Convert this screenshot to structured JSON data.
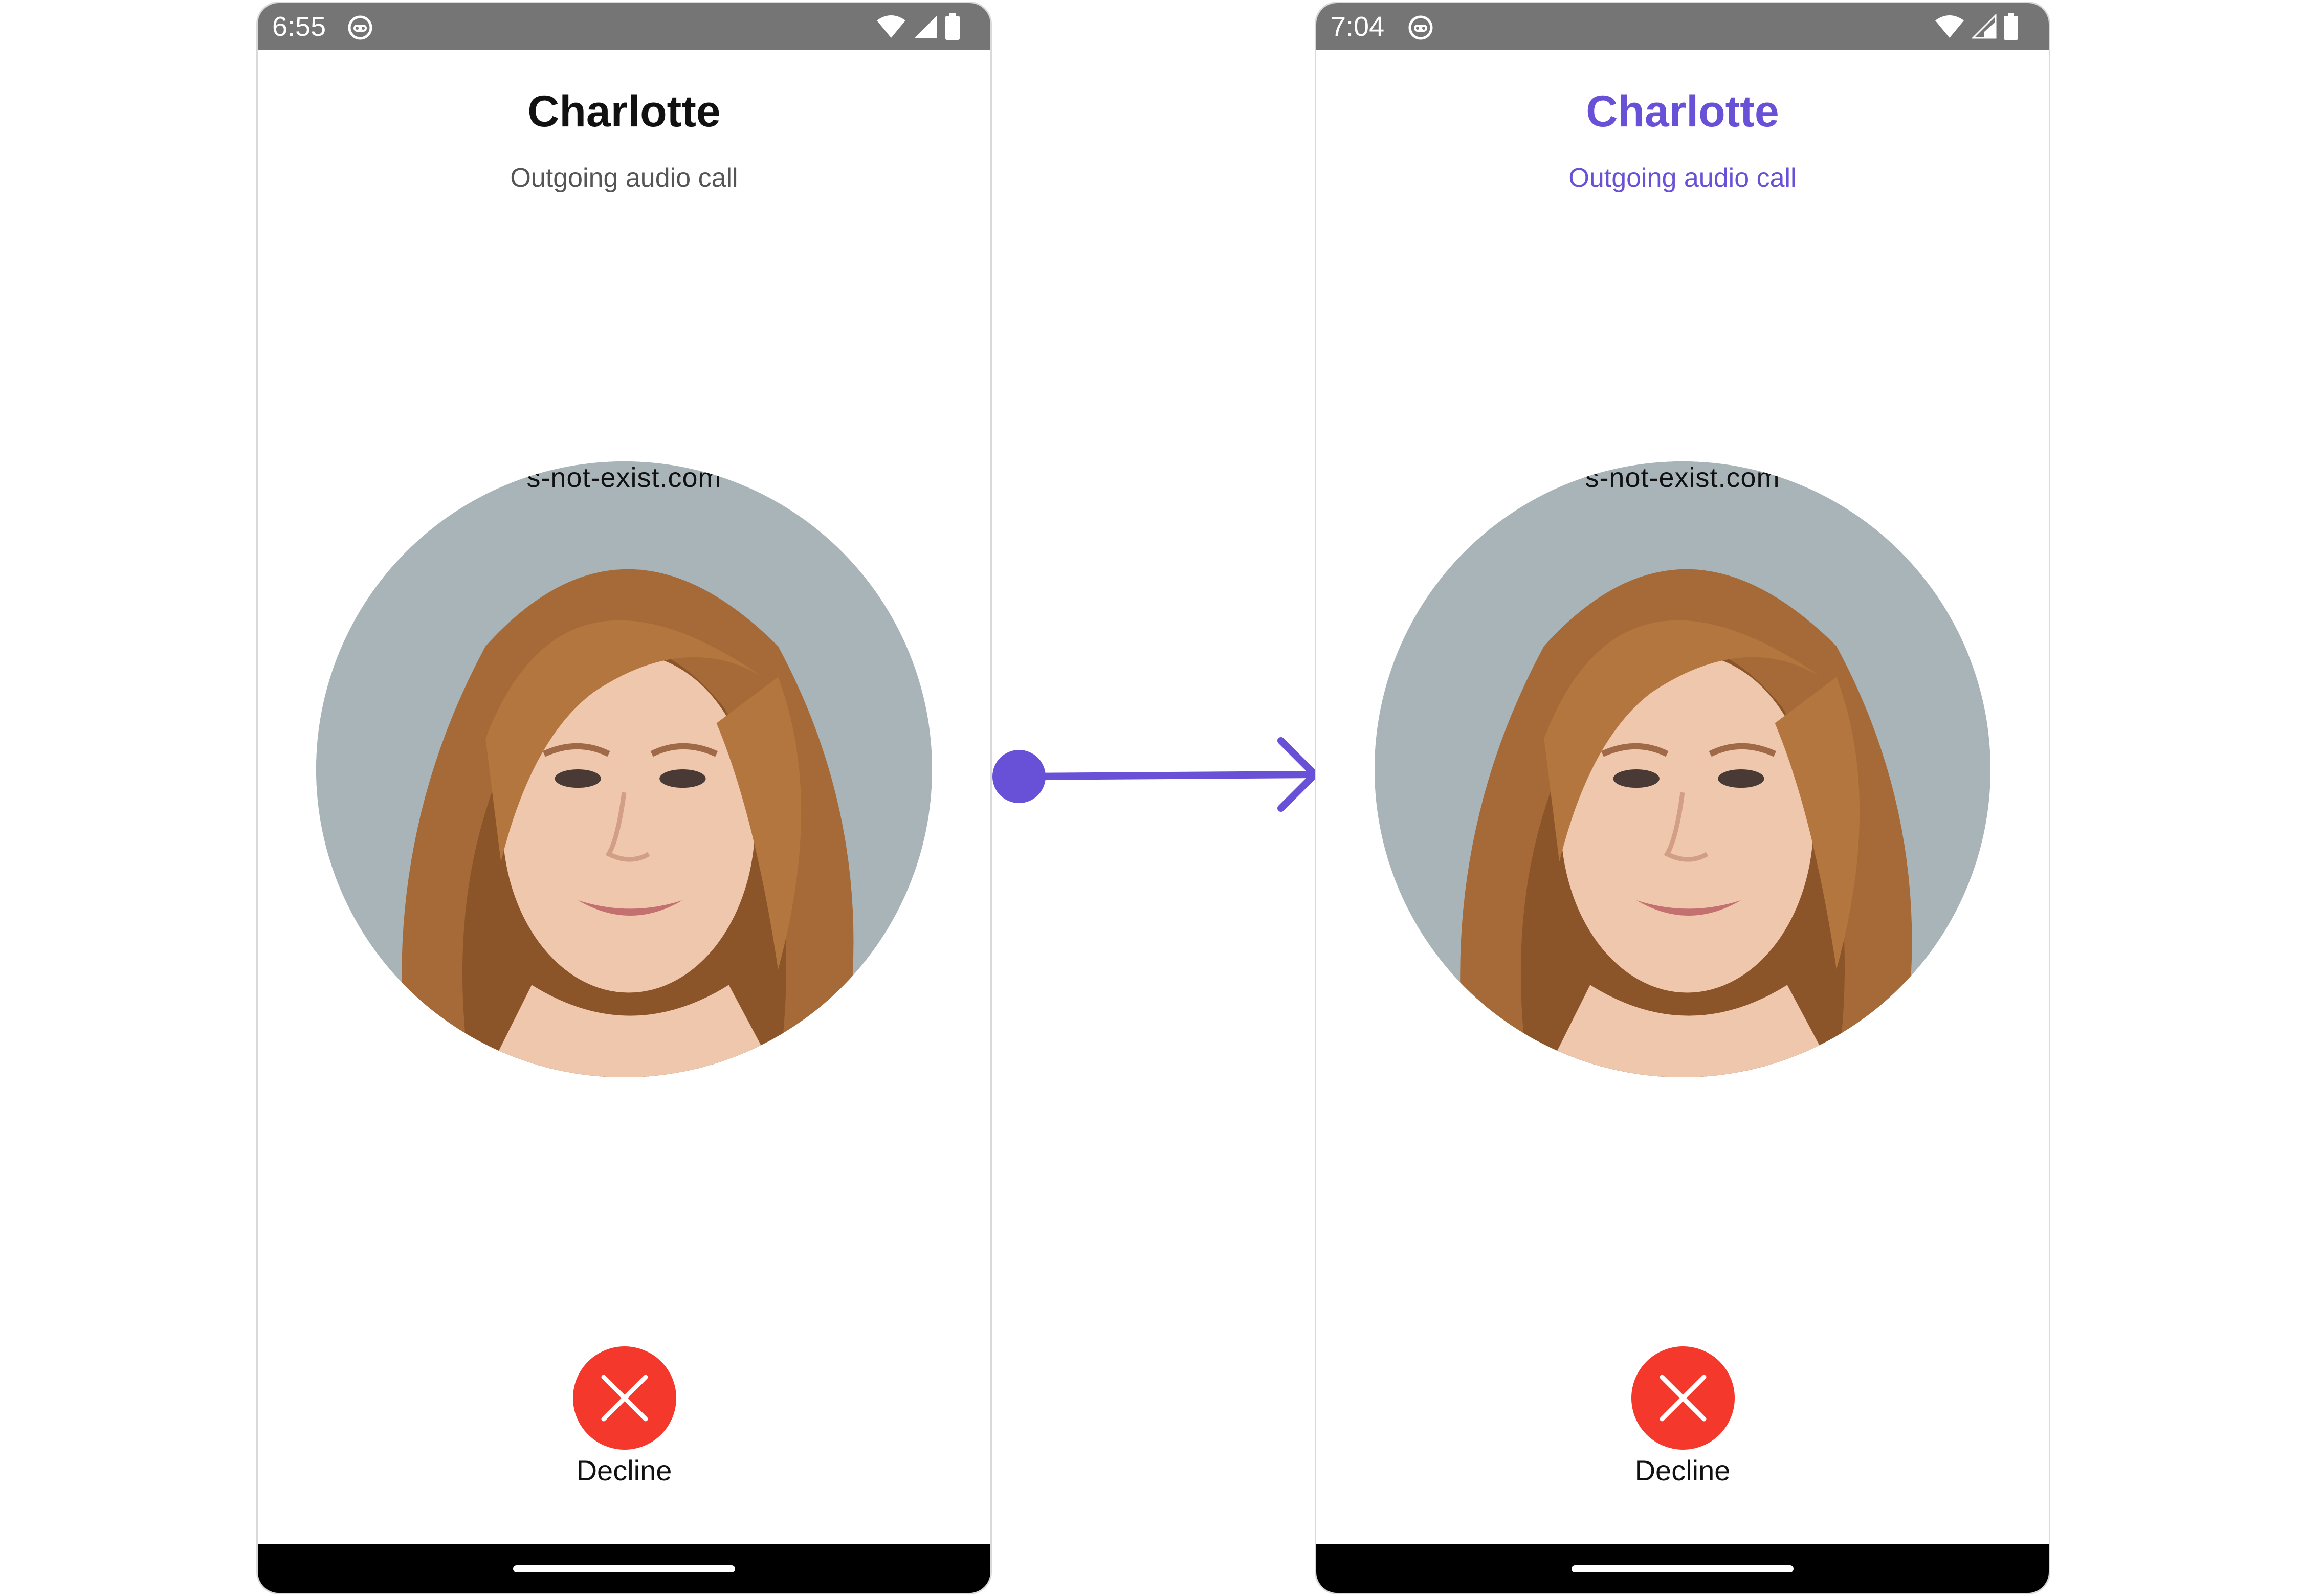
{
  "theme": {
    "default_text": "#111111",
    "default_subtext": "#555555",
    "accent": "#6851d6",
    "decline_red": "#f4392c",
    "status_bar": "#757575"
  },
  "screens": [
    {
      "status_bar": {
        "time": "6:55",
        "app_icon": "launcher-face-icon",
        "icons": [
          "wifi-icon",
          "cellular-signal-icon",
          "battery-icon"
        ]
      },
      "caller": {
        "name": "Charlotte",
        "status": "Outgoing audio call",
        "name_color": "#111111",
        "status_color": "#555555"
      },
      "avatar": {
        "watermark": "s-not-exist.com"
      },
      "decline": {
        "label": "Decline",
        "icon": "close-icon"
      }
    },
    {
      "status_bar": {
        "time": "7:04",
        "app_icon": "launcher-face-icon",
        "icons": [
          "wifi-icon",
          "cellular-signal-icon",
          "battery-icon"
        ]
      },
      "caller": {
        "name": "Charlotte",
        "status": "Outgoing audio call",
        "name_color": "#6851d6",
        "status_color": "#6851d6"
      },
      "avatar": {
        "watermark": "s-not-exist.com"
      },
      "decline": {
        "label": "Decline",
        "icon": "close-icon"
      }
    }
  ],
  "transition_arrow": {
    "icon": "arrow-right-icon",
    "color": "#6851d6"
  }
}
